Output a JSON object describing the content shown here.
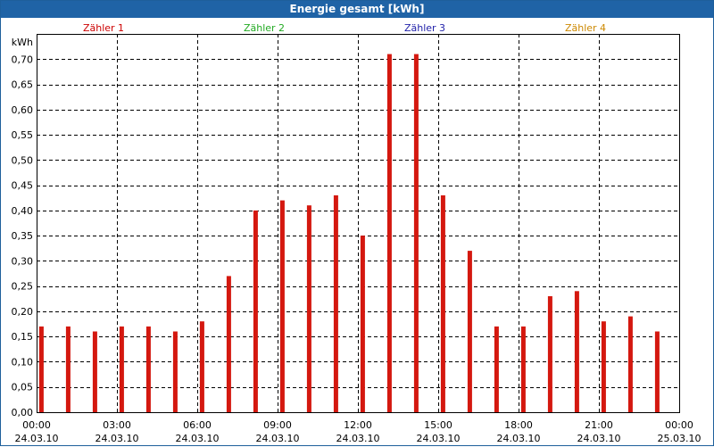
{
  "window": {
    "title": "Energie gesamt [kWh]"
  },
  "colors": {
    "bar": "#d4180f",
    "legend": [
      "#cc0000",
      "#22aa22",
      "#2222aa",
      "#cc8800"
    ],
    "titlebar": "#1f63a6"
  },
  "chart_data": {
    "type": "bar",
    "title": "Energie gesamt [kWh]",
    "ylabel": "kWh",
    "xlabel": "",
    "ylim": [
      0,
      0.75
    ],
    "xlim": [
      "24.03.10 00:00",
      "25.03.10 00:00"
    ],
    "grid": true,
    "legend": {
      "placement": "top",
      "entries": [
        "Zähler 1",
        "Zähler 2",
        "Zähler 3",
        "Zähler 4"
      ]
    },
    "y_ticks": [
      "0,00",
      "0,05",
      "0,10",
      "0,15",
      "0,20",
      "0,25",
      "0,30",
      "0,35",
      "0,40",
      "0,45",
      "0,50",
      "0,55",
      "0,60",
      "0,65",
      "0,70"
    ],
    "x_ticks": [
      {
        "time": "00:00",
        "date": "24.03.10"
      },
      {
        "time": "03:00",
        "date": "24.03.10"
      },
      {
        "time": "06:00",
        "date": "24.03.10"
      },
      {
        "time": "09:00",
        "date": "24.03.10"
      },
      {
        "time": "12:00",
        "date": "24.03.10"
      },
      {
        "time": "15:00",
        "date": "24.03.10"
      },
      {
        "time": "18:00",
        "date": "24.03.10"
      },
      {
        "time": "21:00",
        "date": "24.03.10"
      },
      {
        "time": "00:00",
        "date": "25.03.10"
      }
    ],
    "categories": [
      "24.03.10 00:00",
      "24.03.10 01:00",
      "24.03.10 02:00",
      "24.03.10 03:00",
      "24.03.10 04:00",
      "24.03.10 05:00",
      "24.03.10 06:00",
      "24.03.10 07:00",
      "24.03.10 08:00",
      "24.03.10 09:00",
      "24.03.10 10:00",
      "24.03.10 11:00",
      "24.03.10 12:00",
      "24.03.10 13:00",
      "24.03.10 14:00",
      "24.03.10 15:00",
      "24.03.10 16:00",
      "24.03.10 17:00",
      "24.03.10 18:00",
      "24.03.10 19:00",
      "24.03.10 20:00",
      "24.03.10 21:00",
      "24.03.10 22:00",
      "24.03.10 23:00"
    ],
    "values": [
      0.17,
      0.17,
      0.16,
      0.17,
      0.17,
      0.16,
      0.18,
      0.27,
      0.4,
      0.42,
      0.41,
      0.43,
      0.35,
      0.71,
      0.71,
      0.43,
      0.32,
      0.17,
      0.17,
      0.23,
      0.24,
      0.18,
      0.19,
      0.16
    ]
  }
}
